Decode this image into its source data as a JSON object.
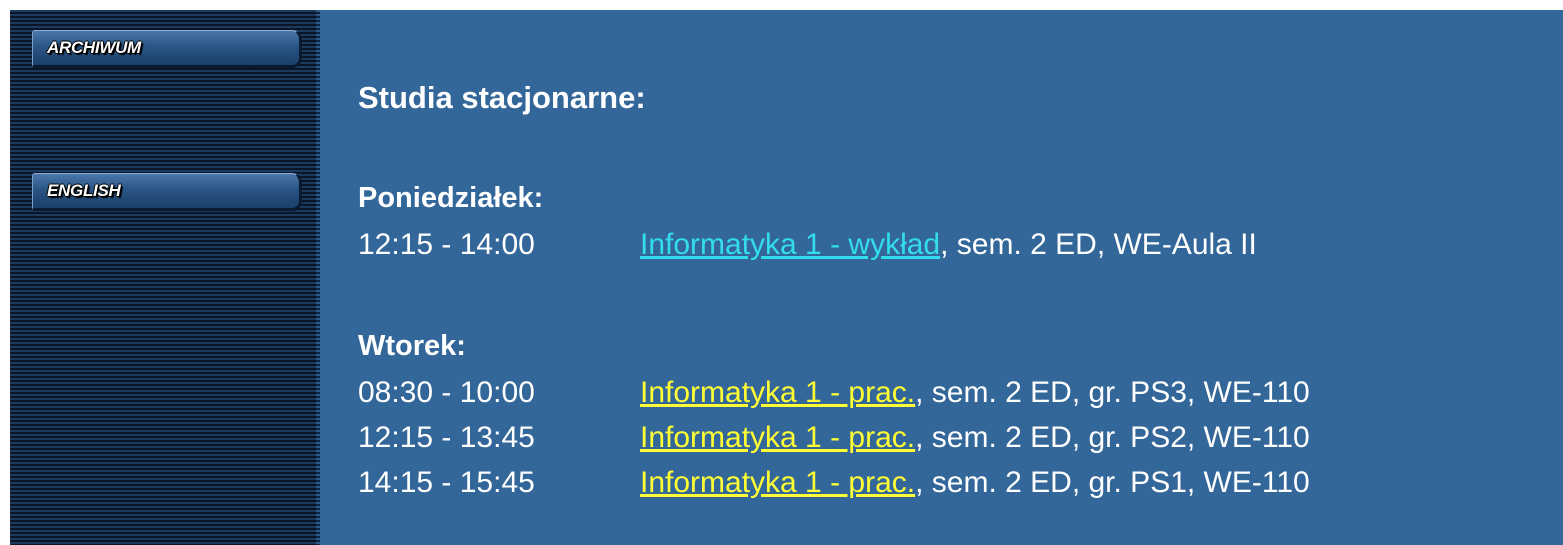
{
  "sidebar": {
    "archive_label": "ARCHIWUM",
    "english_label": "ENGLISH"
  },
  "main": {
    "title": "Studia stacjonarne:",
    "days": [
      {
        "name": "Poniedziałek:",
        "entries": [
          {
            "time": "12:15 - 14:00",
            "link": "Informatyka 1 - wykład",
            "details": ", sem. 2 ED, WE-Aula II"
          }
        ]
      },
      {
        "name": "Wtorek:",
        "entries": [
          {
            "time": "08:30 - 10:00",
            "link": "Informatyka 1 - prac.",
            "details": ", sem. 2 ED, gr. PS3, WE-110"
          },
          {
            "time": "12:15 - 13:45",
            "link": "Informatyka 1 - prac.",
            "details": ", sem. 2 ED, gr. PS2, WE-110"
          },
          {
            "time": "14:15 - 15:45",
            "link": "Informatyka 1 - prac.",
            "details": ", sem. 2 ED, gr. PS1, WE-110"
          }
        ]
      }
    ]
  },
  "colors": {
    "background": "#336699",
    "lecture_link": "#33ddee",
    "lab_link": "#ffff33",
    "text": "#ffffff"
  }
}
